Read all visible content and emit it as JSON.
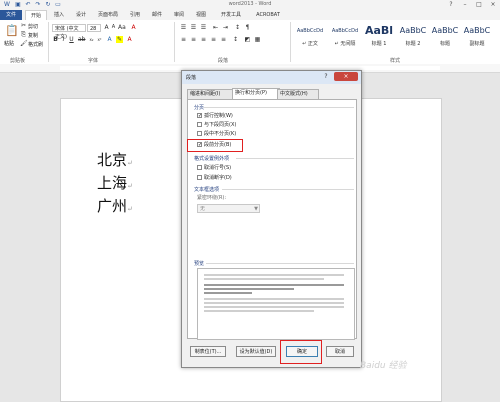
{
  "window": {
    "title": "word2013 - Word"
  },
  "quick_access": [
    "save-icon",
    "undo-icon",
    "redo-icon",
    "refresh-icon",
    "open-icon"
  ],
  "tabs": [
    {
      "label": "文件"
    },
    {
      "label": "开始"
    },
    {
      "label": "插入"
    },
    {
      "label": "设计"
    },
    {
      "label": "页面布局"
    },
    {
      "label": "引用"
    },
    {
      "label": "邮件"
    },
    {
      "label": "审阅"
    },
    {
      "label": "视图"
    },
    {
      "label": "开发工具"
    },
    {
      "label": "ACROBAT"
    }
  ],
  "ribbon": {
    "clipboard": {
      "paste": "粘贴",
      "cut": "剪切",
      "copy": "复制",
      "format_painter": "格式刷",
      "label": "剪贴板"
    },
    "font": {
      "name": "宋体 (中文正⽂)",
      "size": "28",
      "label": "字体"
    },
    "paragraph": {
      "label": "段落"
    },
    "styles": {
      "label": "样式",
      "tiles": [
        {
          "sample": "AaBbCcDd",
          "name": "↵ 正文"
        },
        {
          "sample": "AaBbCcDd",
          "name": "↵ 无间隔"
        },
        {
          "sample": "AaBl",
          "name": "标题 1"
        },
        {
          "sample": "AaBbC",
          "name": "标题 2"
        },
        {
          "sample": "AaBbC",
          "name": "标题"
        },
        {
          "sample": "AaBbC",
          "name": "副标题"
        }
      ]
    }
  },
  "document": {
    "lines": [
      "北京",
      "上海",
      "广州"
    ],
    "mark": "↵"
  },
  "dialog": {
    "title": "段落",
    "help": "?",
    "close": "×",
    "tabs": [
      "缩进和间距(I)",
      "换行和分页(P)",
      "中文版式(H)"
    ],
    "pagination": {
      "title": "分页",
      "options": [
        {
          "label": "孤行控制(W)",
          "checked": true
        },
        {
          "label": "与下段同页(X)",
          "checked": false
        },
        {
          "label": "段中不分页(K)",
          "checked": false
        },
        {
          "label": "段前分页(B)",
          "checked": true
        }
      ]
    },
    "format_exceptions": {
      "title": "格式设置例外项",
      "options": [
        {
          "label": "取消行号(S)",
          "checked": false
        },
        {
          "label": "取消断字(D)",
          "checked": false
        }
      ]
    },
    "textbox": {
      "title": "文本框选项",
      "tight_wrap_label": "紧密环绕(R):",
      "tight_wrap_value": "无"
    },
    "preview": {
      "title": "预览"
    },
    "buttons": {
      "tabs": "制表位(T)...",
      "default": "设为默认值(D)",
      "ok": "确定",
      "cancel": "取消"
    }
  },
  "watermark": "Baidu 经验",
  "colors": {
    "file_tab": "#2b579a",
    "highlight": "#e02020",
    "close": "#c9463d"
  }
}
